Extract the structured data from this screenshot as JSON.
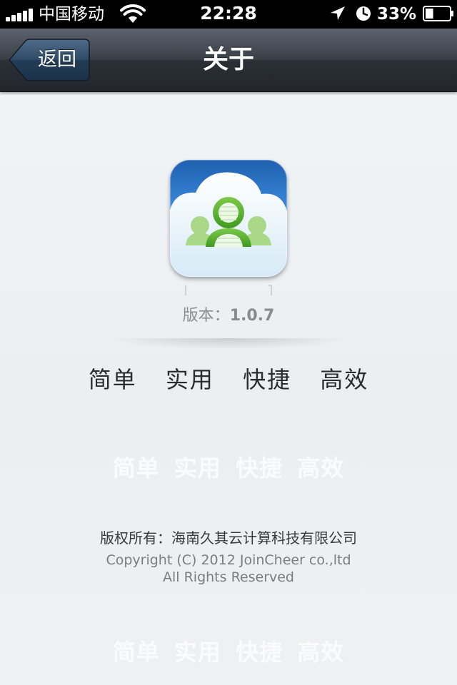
{
  "status_bar": {
    "carrier": "中国移动",
    "time": "22:28",
    "battery_percent": "33%",
    "battery_level": 0.33,
    "signal_bars": 5,
    "icons": [
      "signal-icon",
      "wifi-icon",
      "location-icon",
      "alarm-icon",
      "battery-icon"
    ]
  },
  "nav_bar": {
    "back_label": "返回",
    "title": "关于"
  },
  "app_icon": {
    "icon": "joincheer-cloud-contacts-icon",
    "colors": {
      "sky": "#2f7fd6",
      "cloud": "#eaf4fb",
      "figure": "#5aaf2e"
    }
  },
  "version": {
    "label": "版本：",
    "value": "1.0.7"
  },
  "slogan": {
    "items": [
      "简单",
      "实用",
      "快捷",
      "高效"
    ]
  },
  "copyright": {
    "cn": "版权所有：海南久其云计算科技有限公司",
    "en_line1": "Copyright (C) 2012 JoinCheer co.,ltd",
    "en_line2": "All Rights Reserved"
  }
}
